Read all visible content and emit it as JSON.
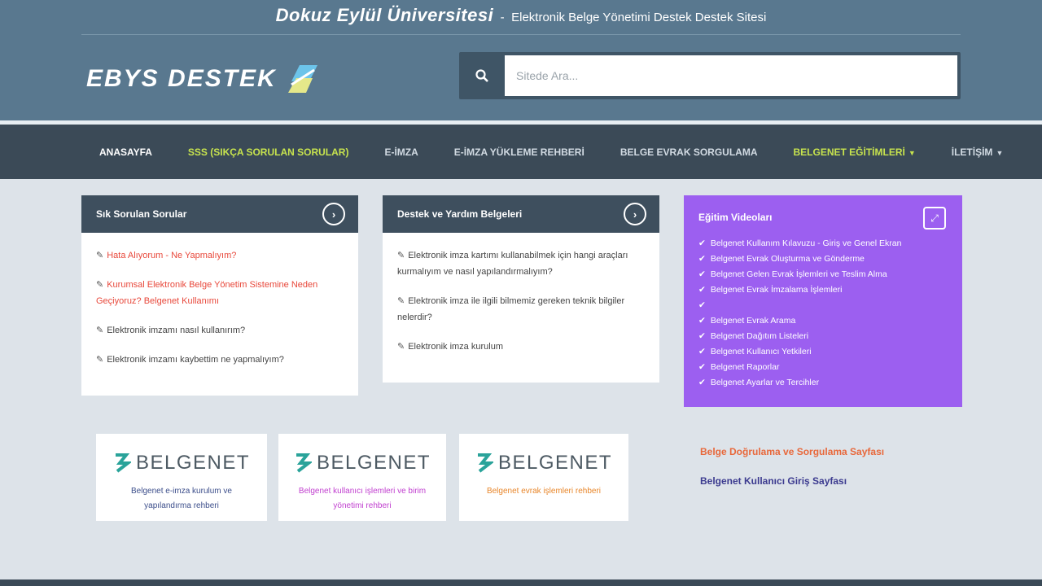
{
  "header": {
    "university": "Dokuz Eylül Üniversitesi",
    "separator": "-",
    "subtitle": "Elektronik Belge Yönetimi Destek Destek Sitesi",
    "logo_text": "EBYS DESTEK",
    "search_placeholder": "Sitede Ara..."
  },
  "nav": {
    "items": [
      {
        "label": "ANASAYFA"
      },
      {
        "label": "SSS (SIKÇA SORULAN SORULAR)"
      },
      {
        "label": "E-İMZA"
      },
      {
        "label": "E-İMZA YÜKLEME REHBERİ"
      },
      {
        "label": "BELGE EVRAK SORGULAMA"
      },
      {
        "label": "BELGENET EĞİTİMLERİ"
      },
      {
        "label": "İLETİŞİM"
      }
    ]
  },
  "card_left": {
    "title": "Sık Sorulan Sorular",
    "items": [
      {
        "text": "Hata Alıyorum - Ne Yapmalıyım?"
      },
      {
        "text": "Kurumsal Elektronik Belge Yönetim Sistemine Neden Geçiyoruz? Belgenet Kullanımı"
      },
      {
        "text": "Elektronik imzamı nasıl kullanırım?"
      },
      {
        "text": "Elektronik imzamı kaybettim ne yapmalıyım?"
      }
    ]
  },
  "card_middle": {
    "title": "Destek ve Yardım Belgeleri",
    "items": [
      {
        "text": "Elektronik imza kartımı kullanabilmek için hangi araçları kurmalıyım ve nasıl yapılandırmalıyım?"
      },
      {
        "text": "Elektronik imza ile ilgili bilmemiz gereken teknik bilgiler nelerdir?"
      },
      {
        "text": "Elektronik imza kurulum"
      }
    ]
  },
  "card_purple": {
    "title": "Eğitim Videoları",
    "items": [
      {
        "text": "Belgenet Kullanım Kılavuzu - Giriş ve Genel Ekran"
      },
      {
        "text": "Belgenet Evrak Oluşturma ve Gönderme"
      },
      {
        "text": "Belgenet Gelen Evrak İşlemleri ve Teslim Alma"
      },
      {
        "text": "Belgenet Evrak İmzalama İşlemleri"
      },
      {
        "text": ""
      },
      {
        "text": "Belgenet Evrak Arama"
      },
      {
        "text": "Belgenet Dağıtım Listeleri"
      },
      {
        "text": "Belgenet Kullanıcı Yetkileri"
      },
      {
        "text": "Belgenet Raporlar"
      },
      {
        "text": "Belgenet Ayarlar ve Tercihler"
      }
    ]
  },
  "belgenet": {
    "brand": "BELGENET",
    "boxes": [
      {
        "caption": "Belgenet e-imza kurulum ve yapılandırma rehberi"
      },
      {
        "caption": "Belgenet kullanıcı işlemleri ve birim yönetimi rehberi"
      },
      {
        "caption": "Belgenet evrak işlemleri rehberi"
      }
    ]
  },
  "sidebar_links": {
    "orange": "Belge Doğrulama ve Sorgulama Sayfası",
    "indigo": "Belgenet Kullanıcı Giriş Sayfası"
  },
  "colors": {
    "header": "#59788f",
    "nav": "#3b4a57",
    "card_head": "#3e4f5e",
    "purple": "#9c5ff0",
    "accent_green": "#c7e34e",
    "accent_red": "#e8483b",
    "accent_orange": "#e8683b",
    "accent_indigo": "#3b3a8f",
    "caption_blue": "#3b4d8a",
    "caption_magenta": "#c03ecf",
    "caption_orange": "#e8862a"
  }
}
